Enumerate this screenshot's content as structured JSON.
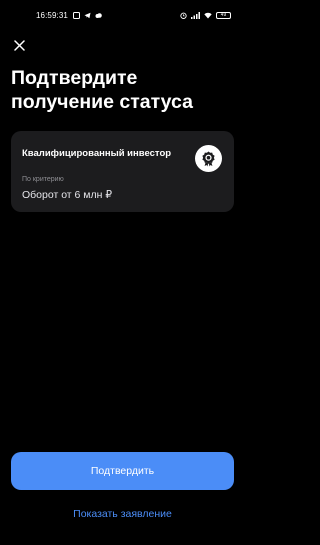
{
  "status_bar": {
    "time": "16:59:31",
    "battery": "49",
    "left_icons": [
      "notification-icon",
      "telegram-icon",
      "cloud-icon"
    ],
    "right_icons": [
      "alarm-icon",
      "signal-icon",
      "wifi-icon",
      "battery-icon"
    ]
  },
  "header": {
    "close_icon": "close-icon",
    "title": "Подтвердите получение статуса"
  },
  "card": {
    "title": "Квалифицированный инвестор",
    "badge_icon": "award-icon",
    "criterion_label": "По критерию",
    "criterion_value": "Оборот от 6 млн ₽"
  },
  "actions": {
    "confirm_label": "Подтвердить",
    "show_statement_label": "Показать заявление"
  },
  "colors": {
    "background": "#000000",
    "card": "#1c1c1e",
    "accent": "#4b8df7",
    "muted_text": "#8e8e93"
  }
}
